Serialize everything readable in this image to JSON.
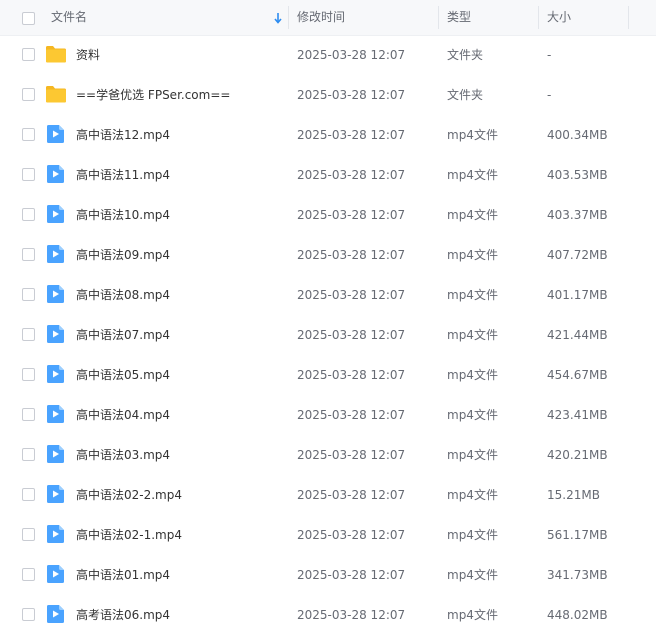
{
  "header": {
    "name_label": "文件名",
    "time_label": "修改时间",
    "type_label": "类型",
    "size_label": "大小"
  },
  "colors": {
    "folder": "#fcc832",
    "video": "#4aa3ff",
    "header_bg": "#f7f8fa",
    "sort_arrow": "#2d8cf0"
  },
  "rows": [
    {
      "icon": "folder-icon",
      "name": "资料",
      "time": "2025-03-28 12:07",
      "type": "文件夹",
      "size": "-"
    },
    {
      "icon": "folder-icon",
      "name": "==学爸优选 FPSer.com==",
      "time": "2025-03-28 12:07",
      "type": "文件夹",
      "size": "-"
    },
    {
      "icon": "video-file-icon",
      "name": "高中语法12.mp4",
      "time": "2025-03-28 12:07",
      "type": "mp4文件",
      "size": "400.34MB"
    },
    {
      "icon": "video-file-icon",
      "name": "高中语法11.mp4",
      "time": "2025-03-28 12:07",
      "type": "mp4文件",
      "size": "403.53MB"
    },
    {
      "icon": "video-file-icon",
      "name": "高中语法10.mp4",
      "time": "2025-03-28 12:07",
      "type": "mp4文件",
      "size": "403.37MB"
    },
    {
      "icon": "video-file-icon",
      "name": "高中语法09.mp4",
      "time": "2025-03-28 12:07",
      "type": "mp4文件",
      "size": "407.72MB"
    },
    {
      "icon": "video-file-icon",
      "name": "高中语法08.mp4",
      "time": "2025-03-28 12:07",
      "type": "mp4文件",
      "size": "401.17MB"
    },
    {
      "icon": "video-file-icon",
      "name": "高中语法07.mp4",
      "time": "2025-03-28 12:07",
      "type": "mp4文件",
      "size": "421.44MB"
    },
    {
      "icon": "video-file-icon",
      "name": "高中语法05.mp4",
      "time": "2025-03-28 12:07",
      "type": "mp4文件",
      "size": "454.67MB"
    },
    {
      "icon": "video-file-icon",
      "name": "高中语法04.mp4",
      "time": "2025-03-28 12:07",
      "type": "mp4文件",
      "size": "423.41MB"
    },
    {
      "icon": "video-file-icon",
      "name": "高中语法03.mp4",
      "time": "2025-03-28 12:07",
      "type": "mp4文件",
      "size": "420.21MB"
    },
    {
      "icon": "video-file-icon",
      "name": "高中语法02-2.mp4",
      "time": "2025-03-28 12:07",
      "type": "mp4文件",
      "size": "15.21MB"
    },
    {
      "icon": "video-file-icon",
      "name": "高中语法02-1.mp4",
      "time": "2025-03-28 12:07",
      "type": "mp4文件",
      "size": "561.17MB"
    },
    {
      "icon": "video-file-icon",
      "name": "高中语法01.mp4",
      "time": "2025-03-28 12:07",
      "type": "mp4文件",
      "size": "341.73MB"
    },
    {
      "icon": "video-file-icon",
      "name": "高考语法06.mp4",
      "time": "2025-03-28 12:07",
      "type": "mp4文件",
      "size": "448.02MB"
    }
  ]
}
